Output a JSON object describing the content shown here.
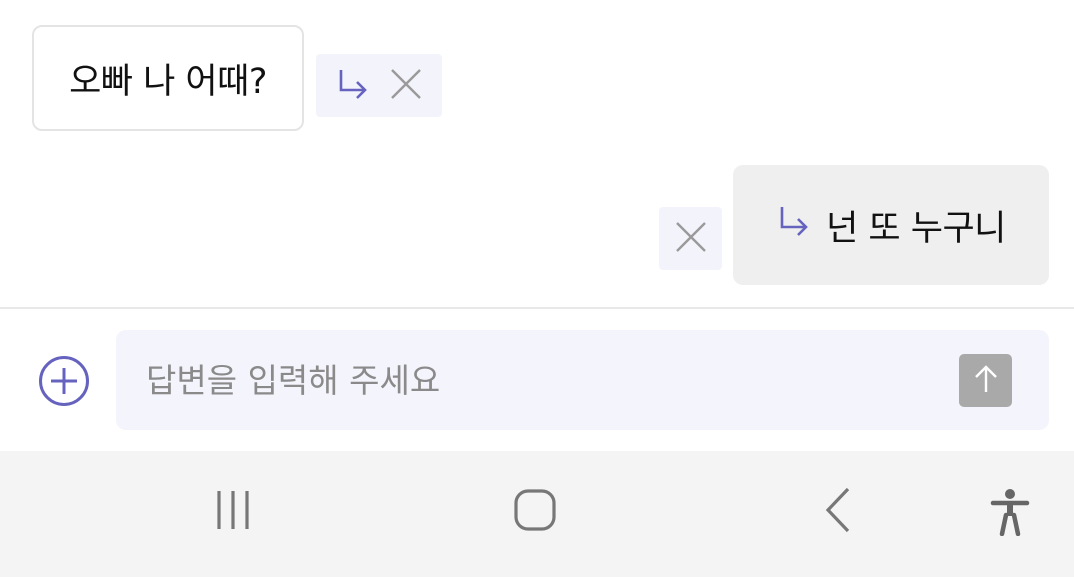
{
  "chat": {
    "incoming_message": "오빠 나 어때?",
    "outgoing_message": "넌 또 누구니"
  },
  "icons": {
    "reply": "reply-arrow-icon",
    "close": "close-icon",
    "add": "plus-circle-icon",
    "send": "arrow-up-icon",
    "recents": "recents-icon",
    "home": "home-icon",
    "back": "back-icon",
    "accessibility": "accessibility-icon"
  },
  "input": {
    "placeholder": "답변을 입력해 주세요",
    "value": ""
  },
  "colors": {
    "accent": "#6663bf",
    "chip_bg": "#f3f3fb",
    "outgoing_bubble_bg": "#efefef",
    "input_bg": "#f4f4fc",
    "send_button_bg": "#a9a9a9",
    "navbar_bg": "#f4f4f4"
  }
}
